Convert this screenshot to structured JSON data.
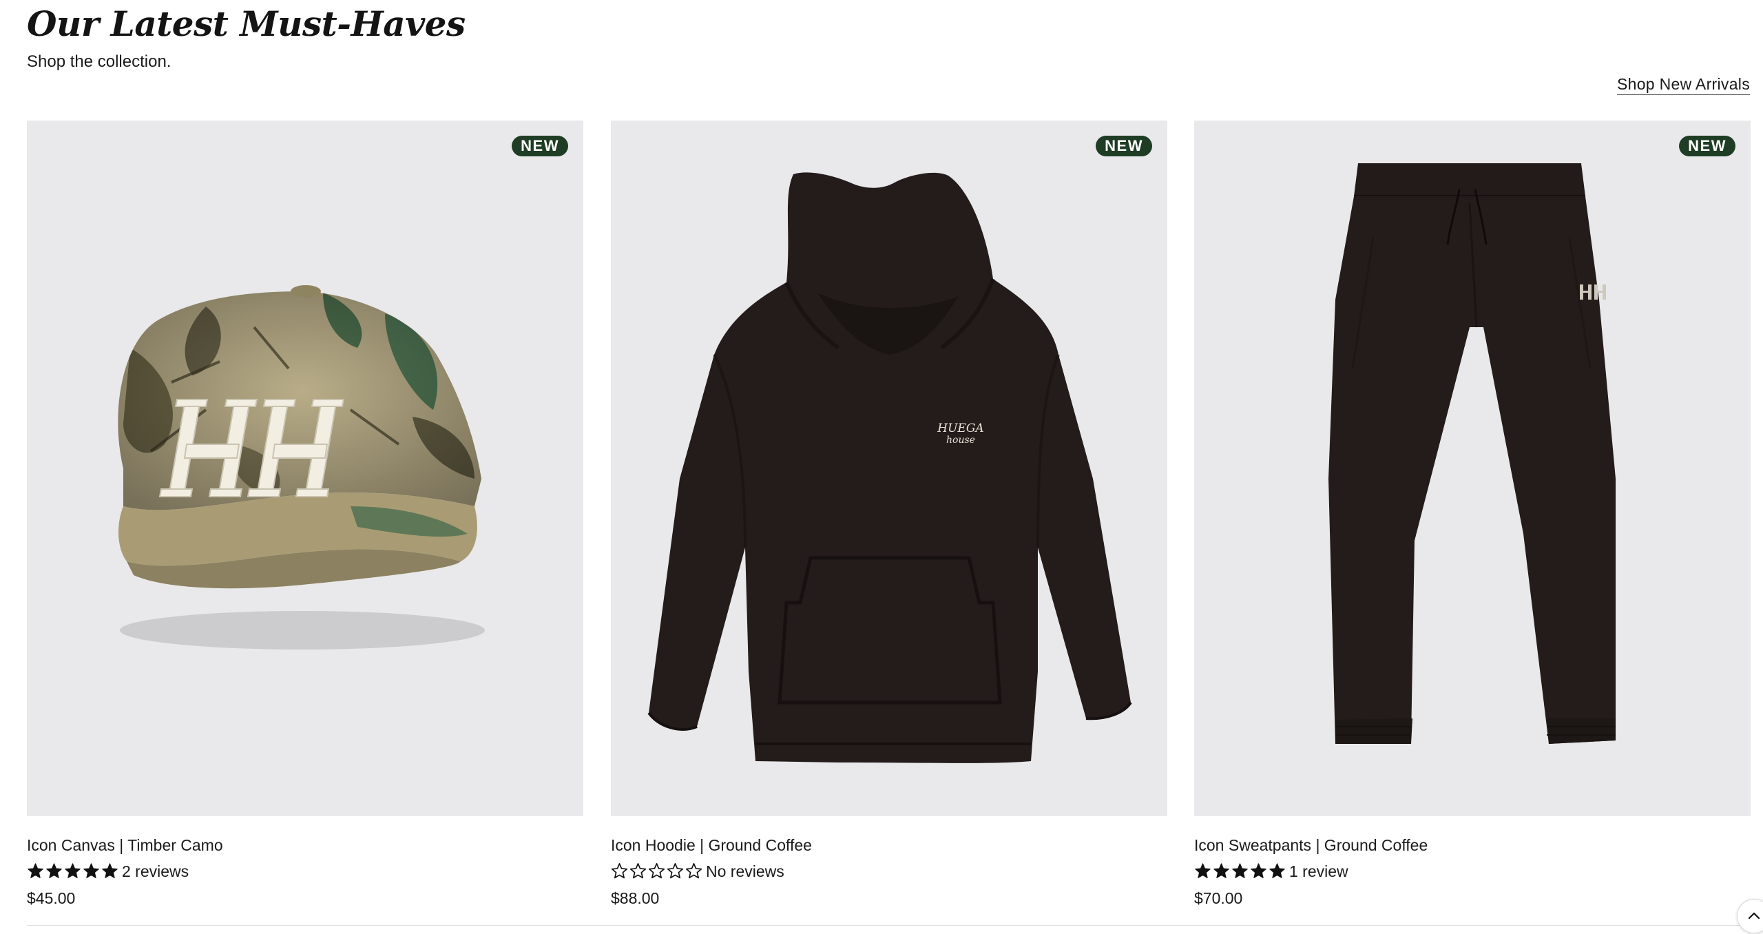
{
  "section": {
    "title": "Our Latest Must-Haves",
    "subtitle": "Shop the collection.",
    "shop_link": "Shop New Arrivals"
  },
  "products": [
    {
      "name": "Icon Canvas | Timber Camo",
      "badge": "NEW",
      "rating": 5,
      "reviews_text": "2 reviews",
      "price": "$45.00",
      "image_icon": "camo-cap-icon"
    },
    {
      "name": "Icon Hoodie | Ground Coffee",
      "badge": "NEW",
      "rating": 0,
      "reviews_text": "No reviews",
      "price": "$88.00",
      "image_icon": "hoodie-icon",
      "print_line1": "HUEGA",
      "print_line2": "house"
    },
    {
      "name": "Icon Sweatpants | Ground Coffee",
      "badge": "NEW",
      "rating": 5,
      "reviews_text": "1 review",
      "price": "$70.00",
      "image_icon": "sweatpants-icon"
    }
  ],
  "colors": {
    "badge_bg": "#1f3d24",
    "image_bg": "#e9e9eb",
    "garment": "#241c1a",
    "camo_base": "#b9ad88"
  },
  "scroll_top": {
    "icon": "chevron-up-icon"
  }
}
